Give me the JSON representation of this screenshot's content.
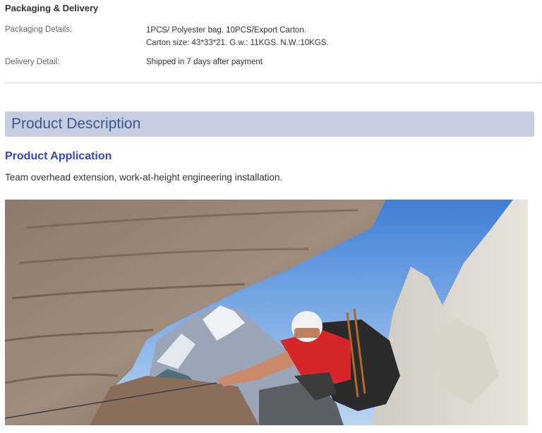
{
  "packaging": {
    "title": "Packaging & Delivery",
    "packaging_label": "Packaging Details:",
    "packaging_line1": "1PCS/ Polyester bag. 10PCS/Export Carton.",
    "packaging_line2": "Carton size: 43*33*21. G.w.: 11KGS. N.W.:10KGS.",
    "delivery_label": "Delivery Detail:",
    "delivery_value": "Shipped in 7 days after payment"
  },
  "description": {
    "bar_title": "Product Description",
    "application_title": "Product Application",
    "application_text": "Team overhead extension, work-at-height engineering installation."
  },
  "colors": {
    "bar_bg": "#c6cde0",
    "bar_text": "#3a5a8e",
    "application_title": "#3344cc"
  }
}
